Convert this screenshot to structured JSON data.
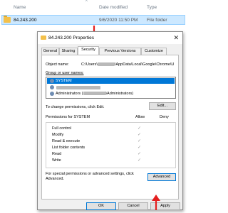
{
  "explorer": {
    "columns": {
      "name": "Name",
      "date": "Date modified",
      "type": "Type"
    },
    "row": {
      "name": "84.243.200",
      "date": "9/6/2020 11:50 PM",
      "type": "File folder"
    }
  },
  "dialog": {
    "title": "84.243.200 Properties",
    "close_glyph": "✕",
    "tabs": [
      "General",
      "Sharing",
      "Security",
      "Previous Versions",
      "Customize"
    ],
    "active_tab": "Security",
    "object_name_label": "Object name:",
    "object_name_prefix": "C:\\Users\\",
    "object_name_suffix": "\\AppData\\Local\\Google\\Chrome\\U",
    "group_label": "Group or user names:",
    "groups": [
      {
        "name": "SYSTEM",
        "selected": true
      },
      {
        "name": "",
        "selected": false
      },
      {
        "name": "Administrators (",
        "suffix": "\\Administrators)",
        "selected": false
      }
    ],
    "change_perm_text": "To change permissions, click Edit.",
    "edit_button": "Edit...",
    "permissions_for": "Permissions for SYSTEM",
    "allow_label": "Allow",
    "deny_label": "Deny",
    "permissions": [
      {
        "name": "Full control",
        "allow": true
      },
      {
        "name": "Modify",
        "allow": true
      },
      {
        "name": "Read & execute",
        "allow": true
      },
      {
        "name": "List folder contents",
        "allow": true
      },
      {
        "name": "Read",
        "allow": true
      },
      {
        "name": "Write",
        "allow": true
      }
    ],
    "check_glyph": "✓",
    "special_text": "For special permissions or advanced settings, click Advanced.",
    "advanced_button": "Advanced",
    "ok_button": "OK",
    "cancel_button": "Cancel",
    "apply_button": "Apply"
  },
  "colors": {
    "arrow": "#e41e1e",
    "selection": "#0078d7",
    "folder": "#f3c04a"
  }
}
